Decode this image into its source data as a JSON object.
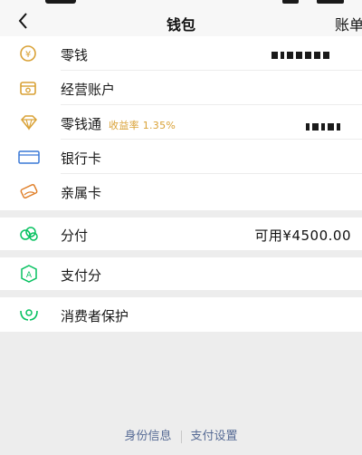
{
  "header": {
    "title": "钱包",
    "back_icon": "chevron-left-icon",
    "right_label": "账单"
  },
  "colors": {
    "accent_green": "#07c160",
    "gold": "#d9a135",
    "blue": "#576b95",
    "background": "#ededed"
  },
  "menu": {
    "change": {
      "label": "零钱",
      "icon": "yuan-coin-icon",
      "value_masked": true
    },
    "business": {
      "label": "经营账户",
      "icon": "business-account-icon"
    },
    "lingqiantong": {
      "label": "零钱通",
      "rate": "收益率 1.35%",
      "icon": "diamond-icon",
      "value_masked": true
    },
    "bank_card": {
      "label": "银行卡",
      "icon": "bank-card-icon"
    },
    "family_card": {
      "label": "亲属卡",
      "icon": "family-card-icon"
    }
  },
  "fenfu": {
    "label": "分付",
    "value": "可用¥4500.00",
    "icon": "fenfu-cloud-icon"
  },
  "pay_score": {
    "label": "支付分",
    "icon": "pay-score-icon"
  },
  "consumer_protection": {
    "label": "消费者保护",
    "icon": "hands-protect-icon"
  },
  "footer": {
    "identity": "身份信息",
    "pay_settings": "支付设置"
  }
}
